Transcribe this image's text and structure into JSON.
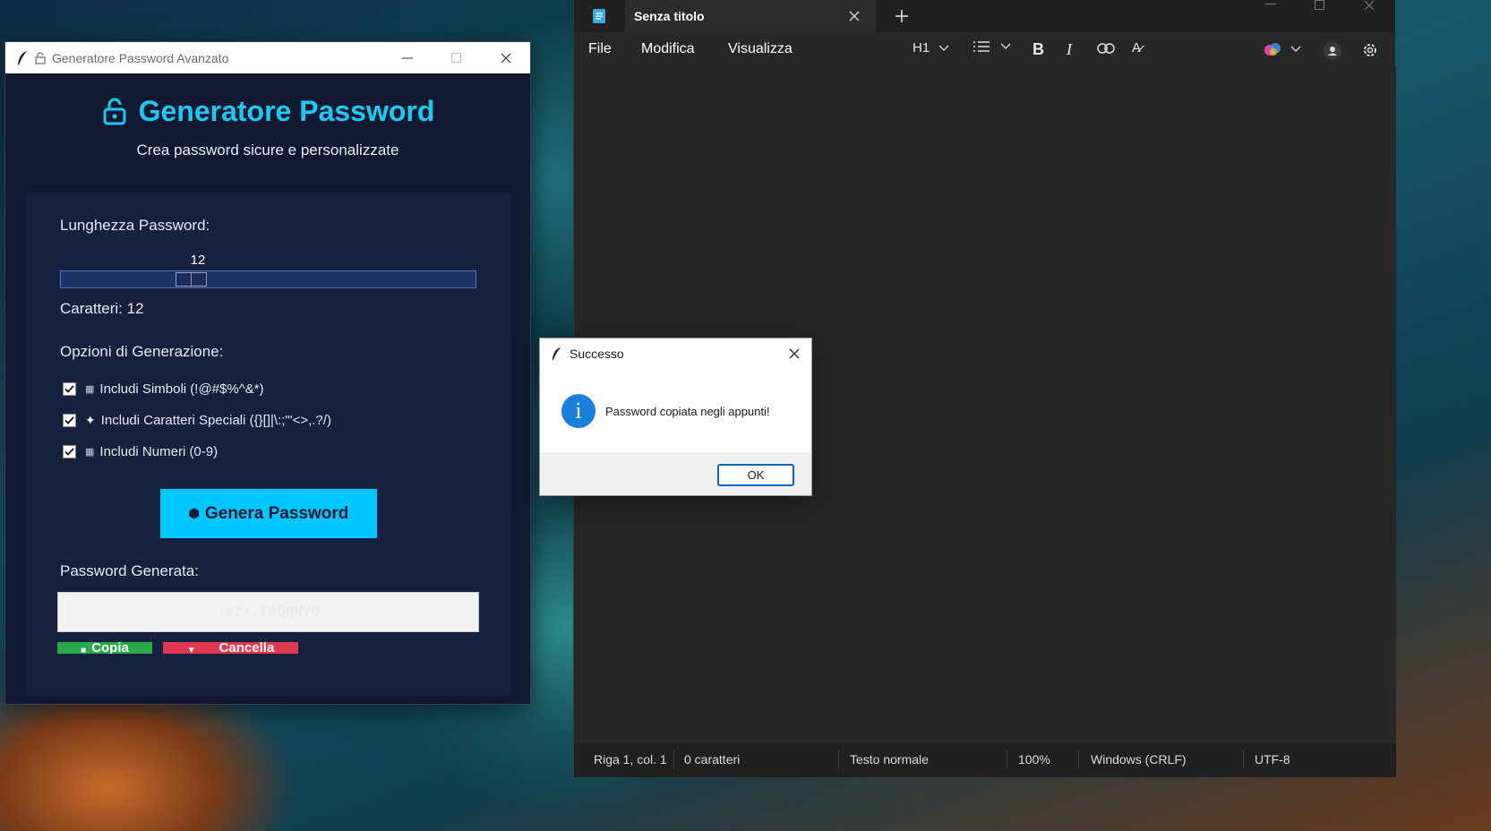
{
  "generator": {
    "window_title": "Generatore Password Avanzato",
    "title": "Generatore Password",
    "subtitle": "Crea password sicure e personalizzate",
    "length_label": "Lunghezza Password:",
    "slider_value": "12",
    "slider_fraction": 0.3,
    "char_count_label": "Caratteri: 12",
    "options_label": "Opzioni di Generazione:",
    "options": [
      {
        "label": "Includi Simboli (!@#$%^&*)",
        "checked": true
      },
      {
        "label": "Includi Caratteri Speciali ({}[]|\\:;\"'<>,.?/)",
        "checked": true
      },
      {
        "label": "Includi Numeri (0-9)",
        "checked": true
      }
    ],
    "generate_button": "Genera Password",
    "output_label": "Password Generata:",
    "password": ":vzx,taQqNVD",
    "copy_button": "Copia",
    "cancel_button": "Cancella",
    "accent_color": "#1ec8f2"
  },
  "notepad": {
    "tab_title": "Senza titolo",
    "menu": [
      "File",
      "Modifica",
      "Visualizza"
    ],
    "heading_select": "H1",
    "status": {
      "position": "Riga 1, col. 1",
      "chars": "0 caratteri",
      "format": "Testo normale",
      "zoom": "100%",
      "line_ending": "Windows (CRLF)",
      "encoding": "UTF-8"
    }
  },
  "dialog": {
    "title": "Successo",
    "message": "Password copiata negli appunti!",
    "ok_button": "OK",
    "icon": "info-icon"
  }
}
